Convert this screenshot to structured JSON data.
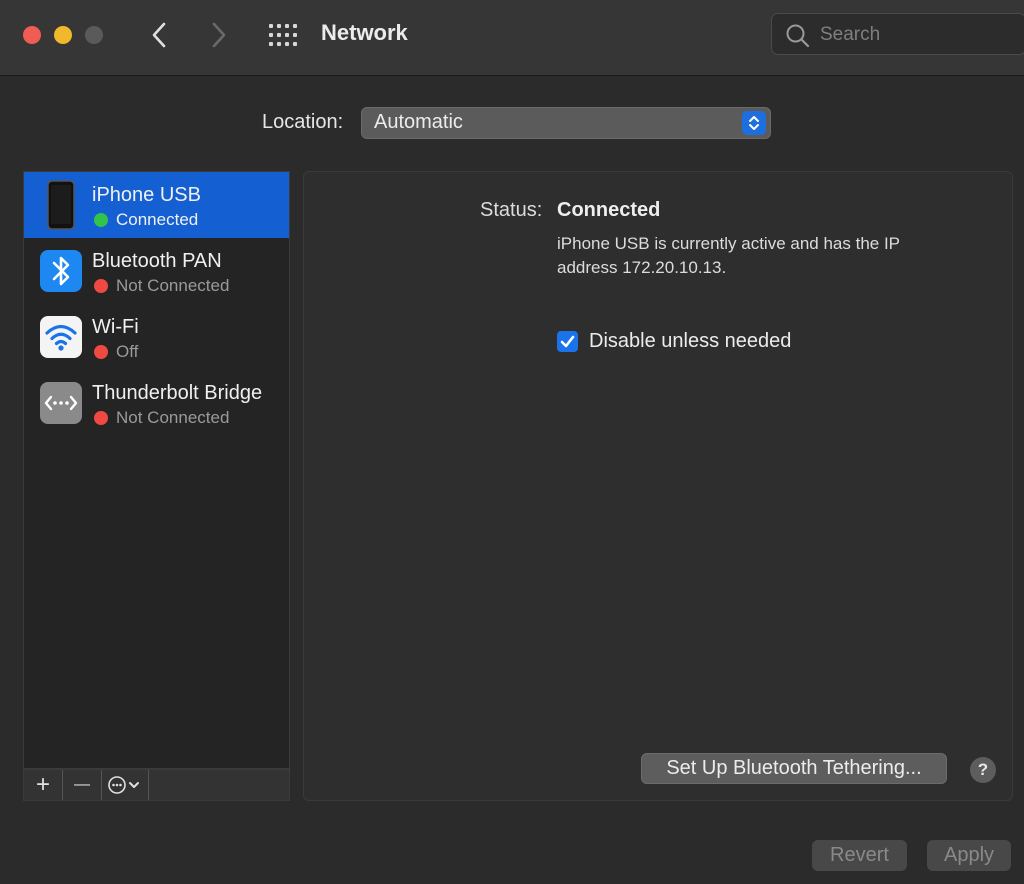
{
  "window": {
    "title": "Network",
    "search_placeholder": "Search"
  },
  "location": {
    "label": "Location:",
    "value": "Automatic"
  },
  "services": [
    {
      "name": "iPhone USB",
      "status": "Connected",
      "status_color": "#33c24a",
      "icon": "iphone-icon",
      "selected": true
    },
    {
      "name": "Bluetooth PAN",
      "status": "Not Connected",
      "status_color": "#ef4a41",
      "icon": "bluetooth-icon",
      "selected": false
    },
    {
      "name": "Wi-Fi",
      "status": "Off",
      "status_color": "#ef4a41",
      "icon": "wifi-icon",
      "selected": false
    },
    {
      "name": "Thunderbolt Bridge",
      "status": "Not Connected",
      "status_color": "#ef4a41",
      "icon": "thunderbolt-bridge-icon",
      "selected": false
    }
  ],
  "sidebar_controls": {
    "add_symbol": "+",
    "remove_symbol": "—",
    "action_icon": "ellipsis-circle-icon"
  },
  "detail": {
    "status_label": "Status:",
    "status_value": "Connected",
    "description": "iPhone USB is currently active and has the IP address 172.20.10.13.",
    "checkbox_label": "Disable unless needed",
    "checkbox_checked": true,
    "tether_button": "Set Up Bluetooth Tethering...",
    "help_symbol": "?"
  },
  "footer": {
    "revert": "Revert",
    "apply": "Apply"
  },
  "colors": {
    "accent": "#1460d2",
    "connected": "#33c24a",
    "disconnected": "#ef4a41"
  }
}
